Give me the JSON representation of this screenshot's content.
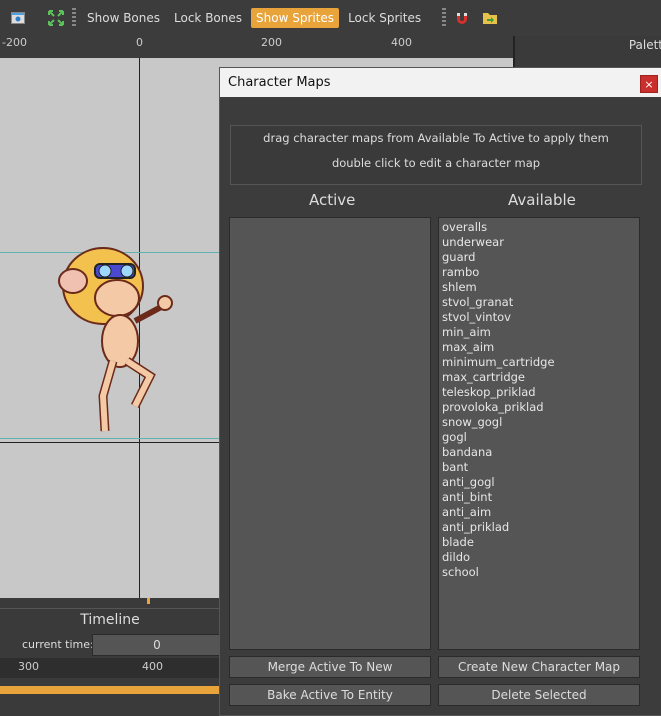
{
  "toolbar": {
    "show_bones": "Show Bones",
    "lock_bones": "Lock Bones",
    "show_sprites": "Show Sprites",
    "lock_sprites": "Lock Sprites"
  },
  "ruler": {
    "ticks": [
      "-200",
      "0",
      "200",
      "400"
    ]
  },
  "right_pane": {
    "palette_label": "Palett"
  },
  "timeline": {
    "title": "Timeline",
    "current_time_label": "current time:",
    "current_time_value": "0",
    "ticks": [
      "300",
      "400"
    ]
  },
  "dialog": {
    "title": "Character Maps",
    "close": "×",
    "info_line1": "drag character maps from Available To Active to apply them",
    "info_line2": "double click to edit a character map",
    "active_header": "Active",
    "available_header": "Available",
    "available_items": [
      "overalls",
      "underwear",
      "guard",
      "rambo",
      "shlem",
      "stvol_granat",
      "stvol_vintov",
      "min_aim",
      "max_aim",
      "minimum_cartridge",
      "max_cartridge",
      "teleskop_priklad",
      "provoloka_priklad",
      "snow_gogl",
      "gogl",
      "bandana",
      "bant",
      "anti_gogl",
      "anti_bint",
      "anti_aim",
      "anti_priklad",
      "blade",
      "dildo",
      "school"
    ],
    "merge_button": "Merge Active To New",
    "create_button": "Create New Character Map",
    "bake_button": "Bake Active To Entity",
    "delete_button": "Delete Selected"
  },
  "colors": {
    "accent": "#e8a33a",
    "close": "#c9302c"
  }
}
